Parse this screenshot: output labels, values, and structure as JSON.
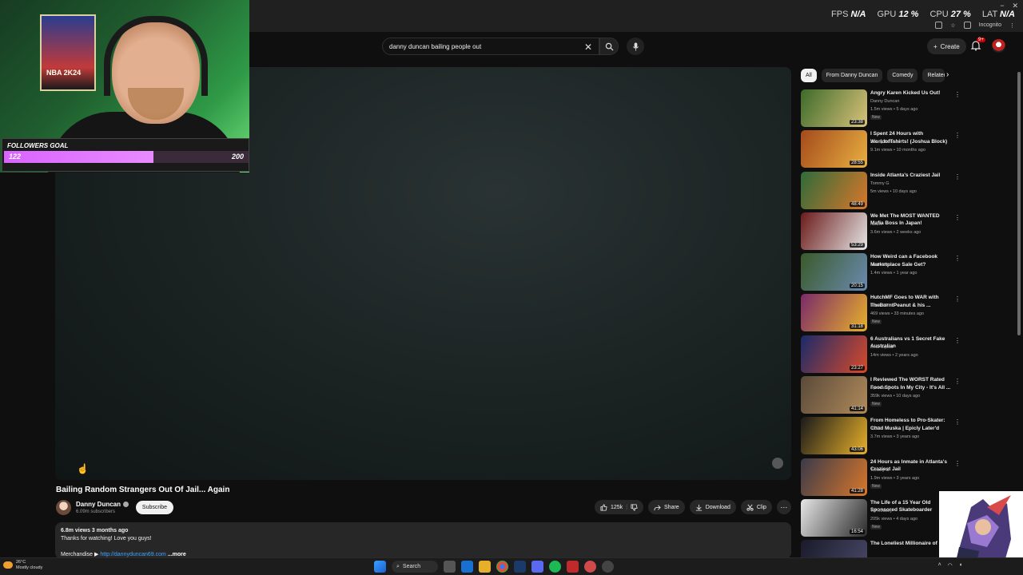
{
  "overlay": {
    "perf": [
      {
        "label": "FPS",
        "value": "N/A"
      },
      {
        "label": "GPU",
        "value": "12 %"
      },
      {
        "label": "CPU",
        "value": "27 %"
      },
      {
        "label": "LAT",
        "value": "N/A"
      }
    ],
    "incognito_label": "Incognito",
    "webcam": {
      "poster_text": "NBA 2K24",
      "goal_label": "FOLLOWERS GOAL",
      "goal_current": "122",
      "goal_max": "200",
      "goal_progress": 0.61
    }
  },
  "header": {
    "search_value": "danny duncan bailing people out",
    "create_label": "Create",
    "notif_badge": "9+"
  },
  "video": {
    "title": "Bailing Random Strangers Out Of Jail... Again",
    "channel_name": "Danny Duncan",
    "subscribers": "6.09m subscribers",
    "subscribe_label": "Subscribe",
    "likes": "125k",
    "share_label": "Share",
    "download_label": "Download",
    "clip_label": "Clip",
    "desc_meta": "6.8m views  3 months ago",
    "desc_line": "Thanks for watching! Love you guys!",
    "desc_merch_prefix": "Merchandise ▶",
    "desc_merch_link": "http://dannyduncan69.com",
    "desc_more": "...more"
  },
  "sidebar": {
    "chips": [
      "All",
      "From Danny Duncan",
      "Comedy",
      "Related"
    ],
    "recommendations": [
      {
        "title": "Angry Karen Kicked Us Out!",
        "channel": "Danny Duncan",
        "meta": "1.5m views • 5 days ago",
        "badge": "New",
        "duration": "23:38",
        "colors": [
          "#3d6a2a",
          "#d9c27a"
        ]
      },
      {
        "title": "I Spent 24 Hours with WorldofTshirts! (Joshua Block)",
        "channel": "Danny Duncan",
        "meta": "9.1m views • 10 months ago",
        "badge": "",
        "duration": "28:55",
        "colors": [
          "#a44a1c",
          "#e8b040"
        ]
      },
      {
        "title": "Inside Atlanta's Craziest Jail",
        "channel": "Tommy G",
        "meta": "5m views • 10 days ago",
        "badge": "",
        "duration": "48:49",
        "colors": [
          "#2f6b3a",
          "#d9772a"
        ]
      },
      {
        "title": "We Met The MOST WANTED Mafia Boss In Japan!",
        "channel": "NELK",
        "meta": "3.6m views • 2 weeks ago",
        "badge": "",
        "duration": "53:29",
        "colors": [
          "#6b1a1a",
          "#e6e6e6"
        ]
      },
      {
        "title": "How Weird can a Facebook Marketplace Sale Get?",
        "channel": "Misfit Minds",
        "meta": "1.4m views • 1 year ago",
        "badge": "",
        "duration": "20:15",
        "colors": [
          "#3a5a2a",
          "#6a8ab0"
        ]
      },
      {
        "title": "HutchMF Goes to WAR with TheBurntPeanut & his ...",
        "channel": "HutchMF",
        "meta": "469 views • 33 minutes ago",
        "badge": "New",
        "duration": "31:18",
        "colors": [
          "#7a2a6a",
          "#e8b02a"
        ]
      },
      {
        "title": "6 Australians vs 1 Secret Fake Australian",
        "channel": "Beta Squad",
        "meta": "14m views • 2 years ago",
        "badge": "",
        "duration": "23:27",
        "colors": [
          "#1a2a6a",
          "#d94a2a"
        ]
      },
      {
        "title": "I Reviewed The WORST Rated Food Spots In My City - It's All ...",
        "channel": "Spanian 2",
        "meta": "359k views • 10 days ago",
        "badge": "New",
        "duration": "41:14",
        "colors": [
          "#5a4a3a",
          "#b08a5a"
        ]
      },
      {
        "title": "From Homeless to Pro-Skater: Chad Muska | Epicly Later'd",
        "channel": "VICE",
        "meta": "3.7m views • 3 years ago",
        "badge": "",
        "duration": "43:06",
        "colors": [
          "#1a1a1a",
          "#e8b02a"
        ]
      },
      {
        "title": "24 Hours as Inmate in Atlanta's Craziest Jail",
        "channel": "Tommy G",
        "meta": "1.9m views • 3 years ago",
        "badge": "New",
        "duration": "41:28",
        "colors": [
          "#3a3a4a",
          "#d9772a"
        ]
      },
      {
        "title": "The Life of a 15 Year Old Sponsored Skateboarder",
        "channel": "Tal Rodkey",
        "meta": "205k views • 4 days ago",
        "badge": "New",
        "duration": "16:54",
        "colors": [
          "#e6e6e6",
          "#2a2a2a"
        ]
      },
      {
        "title": "The Loneliest Millionaire of ...",
        "channel": "",
        "meta": "",
        "badge": "",
        "duration": "",
        "colors": [
          "#1a1a2a",
          "#4a4a6a"
        ]
      }
    ]
  },
  "taskbar": {
    "weather_temp": "26°C",
    "weather_desc": "Mostly cloudy",
    "search_label": "Search"
  }
}
